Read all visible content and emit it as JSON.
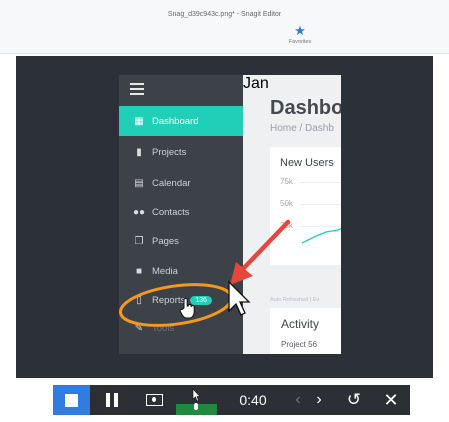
{
  "window": {
    "title": "Snag_d39c943c.png* - Snagit Editor"
  },
  "ribbon": {
    "favorites_label": "Favorites",
    "favorites_icon": "star-icon"
  },
  "app": {
    "sidebar": {
      "items": [
        {
          "label": "Dashboard",
          "icon": "dashboard-icon",
          "active": true
        },
        {
          "label": "Projects",
          "icon": "clipboard-icon"
        },
        {
          "label": "Calendar",
          "icon": "calendar-icon"
        },
        {
          "label": "Contacts",
          "icon": "users-icon"
        },
        {
          "label": "Pages",
          "icon": "pages-icon"
        },
        {
          "label": "Media",
          "icon": "folder-icon"
        },
        {
          "label": "Reports",
          "icon": "report-icon",
          "badge": "136"
        },
        {
          "label": "Tools",
          "icon": "wrench-icon"
        }
      ]
    },
    "main": {
      "title": "Dashbo",
      "breadcrumb": "Home / Dashb",
      "new_users": {
        "title": "New Users",
        "y_ticks": [
          "75k",
          "50k",
          "25k"
        ],
        "x_label": "Jan"
      },
      "refreshed_text": "Auto Refreshed | Ev",
      "activity": {
        "title": "Activity",
        "first_item": "Project 56"
      }
    }
  },
  "recorder": {
    "time": "0:40",
    "accent_color": "#2f7de1",
    "mic_level_color": "#1f8a3e",
    "stop_icon": "stop-icon",
    "pause_icon": "pause-icon",
    "webcam_icon": "webcam-icon",
    "mic_icon": "microphone-icon",
    "prev_icon": "chevron-left-icon",
    "next_icon": "chevron-right-icon",
    "restart_icon": "restart-icon",
    "close_icon": "close-icon"
  },
  "annotations": {
    "arrow_color": "#e8453c",
    "highlight_color": "#f29a1d"
  }
}
